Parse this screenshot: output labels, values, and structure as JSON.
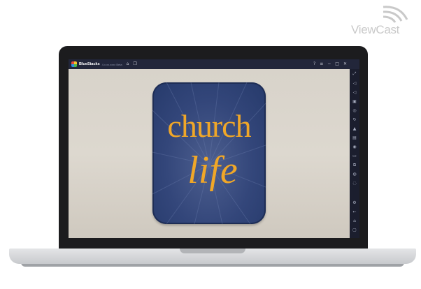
{
  "watermark": {
    "text": "ViewCast"
  },
  "emulator": {
    "title": "BlueStacks",
    "version": "4.x.xx.xxxx Beta",
    "topbar_icons": [
      "home-icon",
      "multi-instance-icon"
    ],
    "window_controls": [
      "help-icon",
      "menu-icon",
      "minimize-icon",
      "maximize-icon",
      "close-icon"
    ]
  },
  "app": {
    "icon_line1": "church",
    "icon_line2": "life",
    "colors": {
      "background": "#2e4275",
      "text": "#f0a728",
      "border": "#1e2d55"
    }
  },
  "sidebar": {
    "items": [
      "fullscreen-icon",
      "volume-up-icon",
      "volume-down-icon",
      "keymapping-icon",
      "screenshot-icon",
      "rotate-icon",
      "install-apk-icon",
      "media-manager-icon",
      "record-icon",
      "folder-icon",
      "copy-icon",
      "location-icon",
      "eco-mode-icon",
      "settings-icon",
      "back-icon",
      "home-nav-icon",
      "recent-apps-icon"
    ]
  }
}
